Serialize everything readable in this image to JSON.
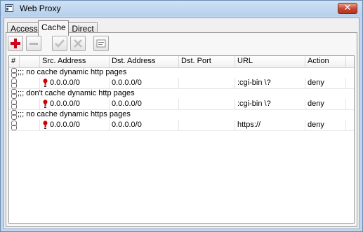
{
  "window": {
    "title": "Web Proxy",
    "close_glyph": "✕"
  },
  "tabs": [
    {
      "label": "Access",
      "active": false
    },
    {
      "label": "Cache",
      "active": true
    },
    {
      "label": "Direct",
      "active": false
    }
  ],
  "toolbar": {
    "buttons": [
      {
        "icon": "add-icon",
        "enabled": true
      },
      {
        "icon": "remove-icon",
        "enabled": false
      },
      {
        "icon": "enable-icon",
        "enabled": false
      },
      {
        "icon": "disable-icon",
        "enabled": false
      },
      {
        "icon": "comment-icon",
        "enabled": true
      }
    ]
  },
  "table": {
    "columns": [
      "#",
      "",
      "Src. Address",
      "Dst. Address",
      "Dst. Port",
      "URL",
      "Action"
    ],
    "rows": [
      {
        "comment": ";;; no cache dynamic http pages",
        "src": "0.0.0.0/0",
        "dst": "0.0.0.0/0",
        "port": "",
        "url": ":cgi-bin \\?",
        "action": "deny"
      },
      {
        "comment": ";;; don't cache dynamic http pages",
        "src": "0.0.0.0/0",
        "dst": "0.0.0.0/0",
        "port": "",
        "url": ":cgi-bin \\?",
        "action": "deny"
      },
      {
        "comment": ";;; no cache dynamic https pages",
        "src": "0.0.0.0/0",
        "dst": "0.0.0.0/0",
        "port": "",
        "url": "https://",
        "action": "deny"
      }
    ]
  },
  "colors": {
    "accent": "#bfd6ee",
    "close": "#c7452f",
    "add": "#d0021b",
    "warn": "#cc0000"
  }
}
